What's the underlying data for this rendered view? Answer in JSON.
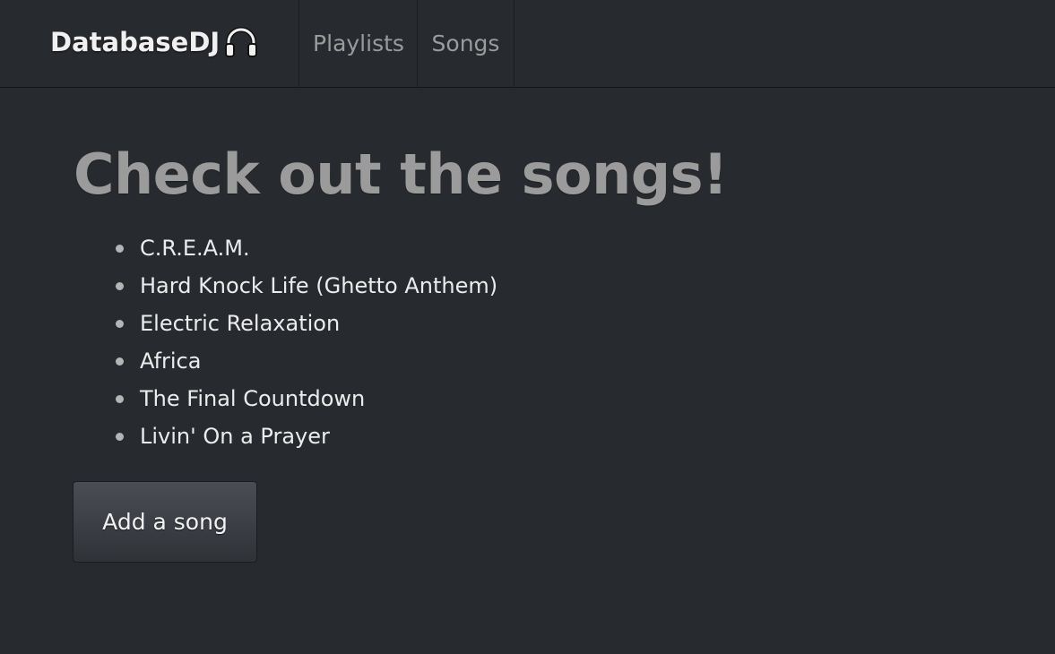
{
  "navbar": {
    "brand": "DatabaseDJ",
    "brand_icon": "headphones-icon",
    "items": [
      {
        "label": "Playlists"
      },
      {
        "label": "Songs"
      }
    ]
  },
  "main": {
    "title": "Check out the songs!",
    "songs": [
      "C.R.E.A.M.",
      "Hard Knock Life (Ghetto Anthem)",
      "Electric Relaxation",
      "Africa",
      "The Final Countdown",
      "Livin' On a Prayer"
    ],
    "add_button_label": "Add a song"
  },
  "colors": {
    "background": "#272a2f",
    "title": "#9b9b9b",
    "nav_text": "#9b9b9b",
    "list_text": "#ececec"
  }
}
